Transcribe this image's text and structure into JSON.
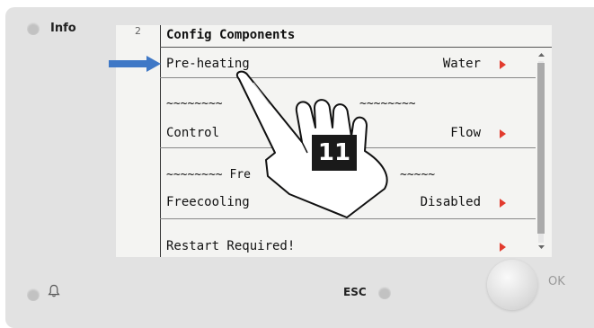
{
  "panel": {
    "info_label": "Info",
    "esc_label": "ESC",
    "ok_label": "OK"
  },
  "screen": {
    "page_number": "2",
    "title": "Config Components",
    "rows": [
      {
        "label": "Pre-heating",
        "value": "Water"
      },
      {
        "label": "Control",
        "value": "Flow"
      },
      {
        "label": "Freecooling",
        "value": "Disabled"
      },
      {
        "label": "Restart Required!",
        "value": ""
      }
    ],
    "separators": [
      "~~~~~~~~",
      "~~~~~~~~",
      "~~~~~~~~ Fre",
      "~~~~~"
    ]
  },
  "overlay": {
    "step_number": "11"
  },
  "colors": {
    "arrow_blue": "#3f78c6",
    "submenu_arrow_red": "#e23b2e"
  },
  "icons": {
    "bell": "bell-icon",
    "pointer": "blue-arrow-icon",
    "hand": "pointing-hand-icon"
  }
}
